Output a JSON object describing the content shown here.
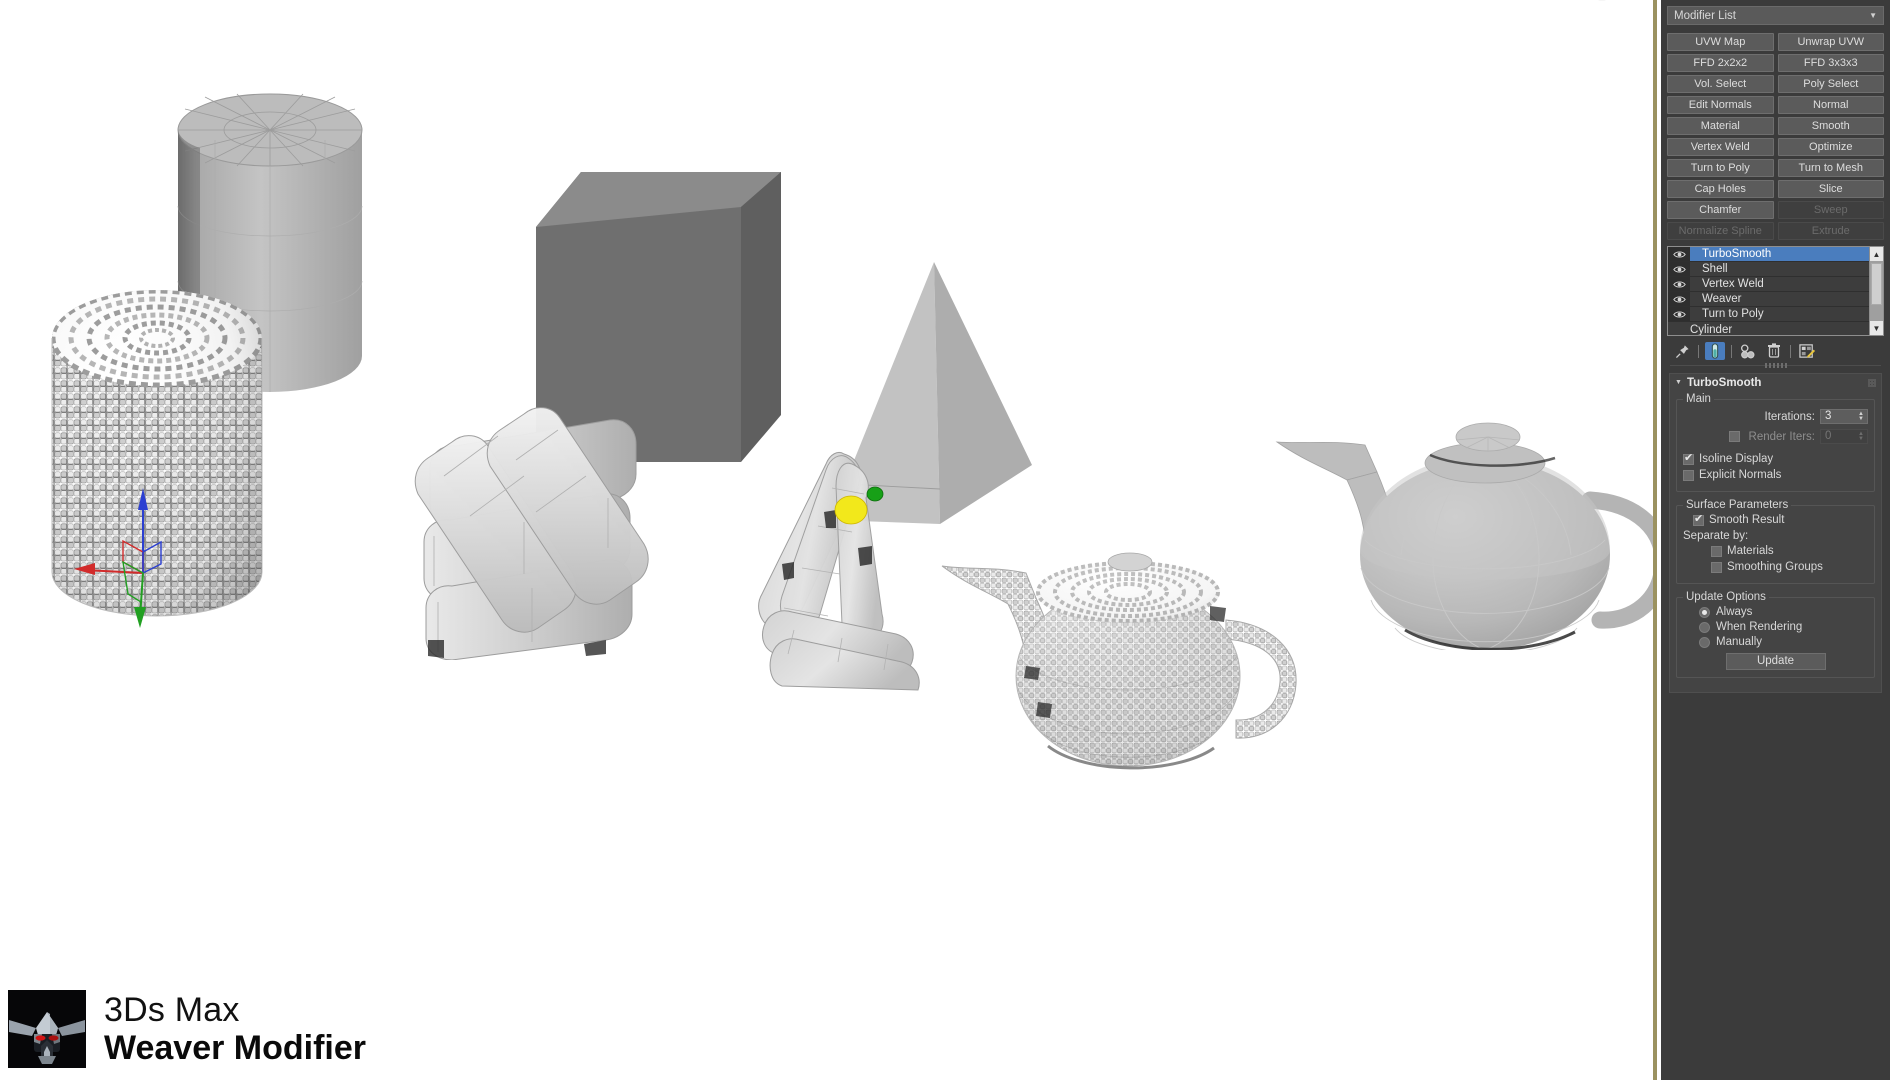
{
  "app": {
    "name": "3Ds Max",
    "subtitle": "Weaver Modifier",
    "logo_icon": "robot-head-icon"
  },
  "viewport": {
    "background_color": "#ffffff",
    "border_color": "#9b9260",
    "viewcube_label": "view-cube",
    "objects": [
      {
        "name": "woven-cylinder",
        "type": "weaver-mesh-cylinder"
      },
      {
        "name": "reference-cylinder",
        "type": "wireframe-cylinder"
      },
      {
        "name": "reference-box",
        "type": "shaded-box"
      },
      {
        "name": "woven-box",
        "type": "weaver-mesh-box"
      },
      {
        "name": "reference-pyramid",
        "type": "shaded-pyramid"
      },
      {
        "name": "woven-pyramid",
        "type": "weaver-mesh-pyramid"
      },
      {
        "name": "reference-teapot",
        "type": "wireframe-teapot"
      },
      {
        "name": "woven-teapot",
        "type": "weaver-mesh-teapot"
      }
    ],
    "gizmo": {
      "x_axis_color": "#d22b2b",
      "y_axis_color": "#22a022",
      "z_axis_color": "#2b3fd2"
    },
    "markers": [
      {
        "name": "yellow-handle",
        "color": "#f2e81b"
      },
      {
        "name": "green-handle",
        "color": "#1aa81a"
      }
    ]
  },
  "command_panel": {
    "modifier_list": {
      "label": "Modifier List",
      "arrow_icon": "chevron-down-icon"
    },
    "modifier_buttons": [
      {
        "label": "UVW Map",
        "enabled": true
      },
      {
        "label": "Unwrap UVW",
        "enabled": true
      },
      {
        "label": "FFD 2x2x2",
        "enabled": true
      },
      {
        "label": "FFD 3x3x3",
        "enabled": true
      },
      {
        "label": "Vol. Select",
        "enabled": true
      },
      {
        "label": "Poly Select",
        "enabled": true
      },
      {
        "label": "Edit Normals",
        "enabled": true
      },
      {
        "label": "Normal",
        "enabled": true
      },
      {
        "label": "Material",
        "enabled": true
      },
      {
        "label": "Smooth",
        "enabled": true
      },
      {
        "label": "Vertex Weld",
        "enabled": true
      },
      {
        "label": "Optimize",
        "enabled": true
      },
      {
        "label": "Turn to Poly",
        "enabled": true
      },
      {
        "label": "Turn to Mesh",
        "enabled": true
      },
      {
        "label": "Cap Holes",
        "enabled": true
      },
      {
        "label": "Slice",
        "enabled": true
      },
      {
        "label": "Chamfer",
        "enabled": true
      },
      {
        "label": "Sweep",
        "enabled": false
      },
      {
        "label": "Normalize Spline",
        "enabled": false
      },
      {
        "label": "Extrude",
        "enabled": false
      }
    ],
    "modifier_stack": {
      "items": [
        {
          "label": "TurboSmooth",
          "selected": true,
          "eye_on": true,
          "is_base": false
        },
        {
          "label": "Shell",
          "selected": false,
          "eye_on": true,
          "is_base": false
        },
        {
          "label": "Vertex Weld",
          "selected": false,
          "eye_on": true,
          "is_base": false
        },
        {
          "label": "Weaver",
          "selected": false,
          "eye_on": true,
          "is_base": false
        },
        {
          "label": "Turn to Poly",
          "selected": false,
          "eye_on": true,
          "is_base": false
        },
        {
          "label": "Cylinder",
          "selected": false,
          "eye_on": false,
          "is_base": true
        }
      ],
      "scroll_up_icon": "chevron-up-icon",
      "scroll_down_icon": "chevron-down-icon"
    },
    "stack_tools": [
      {
        "name": "pin-stack-icon",
        "active": false
      },
      {
        "name": "show-end-result-icon",
        "active": true
      },
      {
        "name": "make-unique-icon",
        "active": false
      },
      {
        "name": "remove-modifier-icon",
        "active": false
      },
      {
        "name": "configure-modifier-sets-icon",
        "active": false
      }
    ],
    "rollout": {
      "title": "TurboSmooth",
      "collapse_icon": "triangle-down-icon",
      "groups": {
        "main": {
          "legend": "Main",
          "iterations_label": "Iterations:",
          "iterations_value": "3",
          "render_iters_label": "Render Iters:",
          "render_iters_value": "0",
          "render_iters_checked": false,
          "render_iters_enabled": false,
          "isoline_display_label": "Isoline Display",
          "isoline_display_checked": true,
          "explicit_normals_label": "Explicit Normals",
          "explicit_normals_checked": false
        },
        "surface": {
          "legend": "Surface Parameters",
          "smooth_result_label": "Smooth Result",
          "smooth_result_checked": true,
          "separate_by_label": "Separate by:",
          "materials_label": "Materials",
          "materials_checked": false,
          "smoothing_groups_label": "Smoothing Groups",
          "smoothing_groups_checked": false
        },
        "update": {
          "legend": "Update Options",
          "options": [
            {
              "label": "Always",
              "selected": true
            },
            {
              "label": "When Rendering",
              "selected": false
            },
            {
              "label": "Manually",
              "selected": false
            }
          ],
          "update_button_label": "Update"
        }
      }
    }
  }
}
